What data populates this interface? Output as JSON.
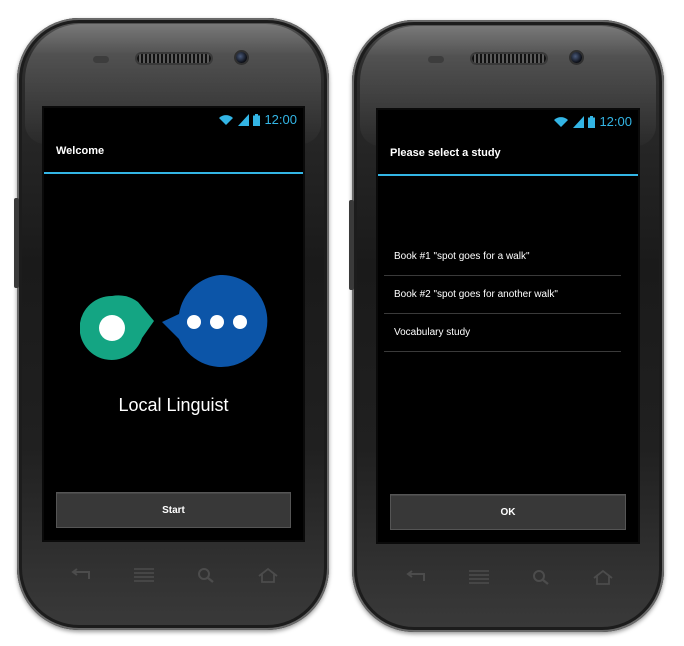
{
  "status_bar": {
    "time": "12:00",
    "icons": [
      "wifi-icon",
      "signal-icon",
      "battery-icon"
    ],
    "accent": "#33b5e5"
  },
  "welcome_screen": {
    "title": "Welcome",
    "app_name": "Local Linguist",
    "start_button": "Start",
    "logo_colors": {
      "green": "#14a583",
      "blue": "#0c55a8"
    }
  },
  "study_screen": {
    "title": "Please select a study",
    "items": [
      "Book #1 \"spot goes for a walk\"",
      "Book #2 \"spot goes for another walk\"",
      "Vocabulary study"
    ],
    "ok_button": "OK"
  },
  "hardware_keys": [
    "back-icon",
    "menu-icon",
    "search-icon",
    "home-icon"
  ]
}
